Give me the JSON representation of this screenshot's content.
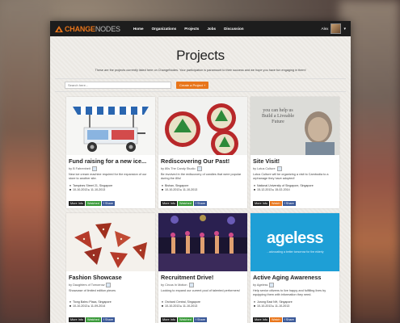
{
  "nav": {
    "logo_main": "CHANGE",
    "logo_rest": "NODES",
    "links": [
      "Home",
      "Organizations",
      "Projects",
      "Jobs",
      "Discussion"
    ],
    "user_name": "Alex"
  },
  "page": {
    "title": "Projects",
    "intro": "These are the projects currently listed here on ChangeNodes. Your participation is paramount to their success and we hope you have fun engaging in them!",
    "search_placeholder": "Search here...",
    "create_label": "Create a Project +"
  },
  "actions": {
    "more": "More Info",
    "share": "f  Share"
  },
  "projects": [
    {
      "title": "Fund raising for a new ice...",
      "by": "by B Fahrenheit",
      "desc": "New ice cream machine required for the expansion of our store to another site.",
      "location": "Tampines Street 21, Singapore",
      "dates": "10-10-2013  ▸  11-10-2013",
      "watch_label": "Watched",
      "watch_state": "watched",
      "image": "ice-cream-cart"
    },
    {
      "title": "Rediscovering Our Past!",
      "by": "by 80s The Candy Studio",
      "desc": "Be involved in the rediscovery of candies that were popular during the 80s!",
      "location": "Bishan, Singapore",
      "dates": "10-10-2013  ▸  11-10-2013",
      "watch_label": "Watched",
      "watch_state": "watched",
      "image": "candy-tins"
    },
    {
      "title": "Site Visit!",
      "by": "by Lotus Culture",
      "desc": "Lotus Culture will be organizing a visit to Cambodia to a orphanage they have adopted!",
      "location": "National University of Singapore, Singapore",
      "dates": "15-12-2013  ▸  15-02-2014",
      "watch_label": "Watch",
      "watch_state": "watch",
      "image": "child-photo",
      "image_text": "you can help us Build a Liveable Future"
    },
    {
      "title": "Fashion Showcase",
      "by": "by Daughters of Tomorrow",
      "desc": "Showcase of limited edition pieces",
      "location": "Tiong Bahru Plaza, Singapore",
      "dates": "10-10-2013  ▸  11-09-2014",
      "watch_label": "Watched",
      "watch_state": "watched",
      "image": "fashion-items"
    },
    {
      "title": "Recruitment Drive!",
      "by": "by Circus In Motion",
      "desc": "Looking to expand our current pool of talented performers!",
      "location": "Orchard Central, Singapore",
      "dates": "10-10-2013  ▸  11-10-2013",
      "watch_label": "Watched",
      "watch_state": "watched",
      "image": "stage-performers"
    },
    {
      "title": "Active Aging Awareness",
      "by": "by Ageless",
      "desc": "Help senior citizens to live happy and fulfilling lives by equipping them with information they need.",
      "location": "Jurong East NH, Singapore",
      "dates": "10-10-2013  ▸  11-10-2013",
      "watch_label": "Watch",
      "watch_state": "watch",
      "image": "ageless-banner",
      "image_text": "ageless",
      "image_small_text": "…advocating a better tomorrow for the elderly"
    }
  ]
}
